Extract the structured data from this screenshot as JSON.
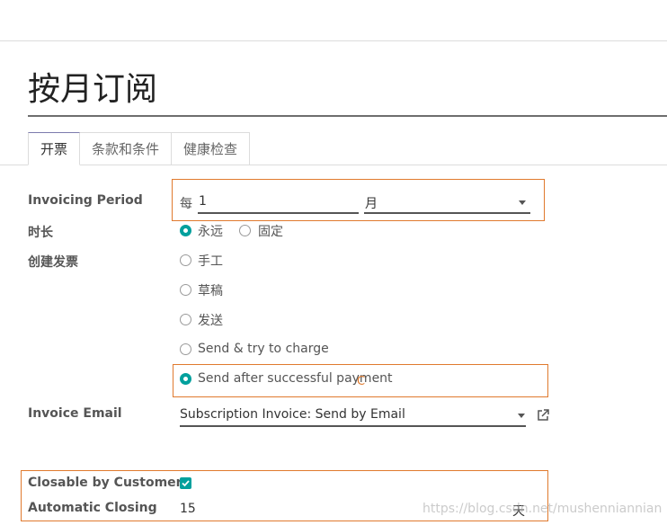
{
  "page": {
    "title": "按月订阅"
  },
  "tabs": [
    {
      "label": "开票"
    },
    {
      "label": "条款和条件"
    },
    {
      "label": "健康检查"
    }
  ],
  "invoicing_period": {
    "label": "Invoicing Period",
    "prefix": "每",
    "value": "1",
    "unit": "月"
  },
  "duration": {
    "label": "时长",
    "options": [
      "永远",
      "固定"
    ],
    "selected": "永远"
  },
  "create_invoice": {
    "label": "创建发票",
    "options": [
      "手工",
      "草稿",
      "发送",
      "Send & try to charge",
      "Send after successful payment"
    ],
    "selected": "Send after successful payment"
  },
  "invoice_email": {
    "label": "Invoice Email",
    "value": "Subscription Invoice: Send by Email"
  },
  "closable_by_customer": {
    "label": "Closable by Customer",
    "checked": true
  },
  "automatic_closing": {
    "label": "Automatic Closing",
    "value": "15",
    "unit": "天"
  },
  "watermark": "https://blog.csdn.net/mushenniannian",
  "colors": {
    "accent": "#00a09d",
    "highlight": "#e07a2e",
    "tab_active": "#7c7bad"
  },
  "icons": {
    "external_link": "external-link-icon",
    "dropdown": "caret-down-icon",
    "check": "check-icon"
  }
}
